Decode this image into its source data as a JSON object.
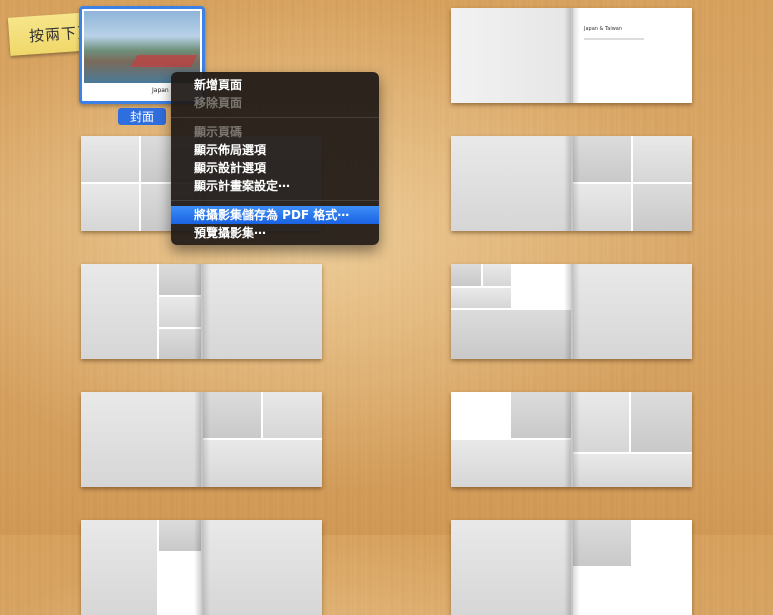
{
  "note": {
    "text": "按兩下頁面來編輯"
  },
  "cover": {
    "label": "封面",
    "page_title": "Japan"
  },
  "spread_title": {
    "title": "Japan & Taiwan"
  },
  "context_menu": {
    "items": [
      {
        "label": "新增頁面",
        "enabled": true
      },
      {
        "label": "移除頁面",
        "enabled": false
      },
      {
        "separator": true
      },
      {
        "label": "顯示頁碼",
        "enabled": false
      },
      {
        "label": "顯示佈局選項",
        "enabled": true
      },
      {
        "label": "顯示設計選項",
        "enabled": true
      },
      {
        "label": "顯示計畫案設定⋯",
        "enabled": true
      },
      {
        "separator": true
      },
      {
        "label": "將攝影集儲存為 PDF 格式⋯",
        "enabled": true,
        "highlighted": true
      },
      {
        "label": "預覽攝影集⋯",
        "enabled": true
      }
    ]
  }
}
